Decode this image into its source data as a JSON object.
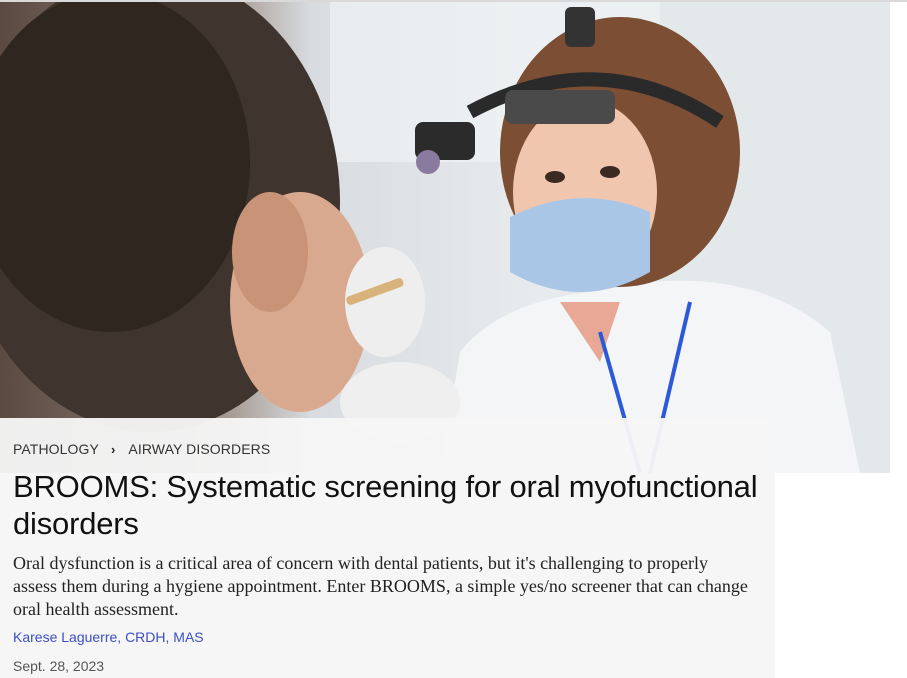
{
  "breadcrumb": {
    "items": [
      "PATHOLOGY",
      "AIRWAY DISORDERS"
    ]
  },
  "article": {
    "title": "BROOMS: Systematic screening for oral myofunctional disorders",
    "summary": "Oral dysfunction is a critical area of concern with dental patients, but it's challenging to properly assess them during a hygiene appointment. Enter BROOMS, a simple yes/no screener that can change oral health assessment.",
    "author": "Karese Laguerre, CRDH, MAS",
    "date": "Sept. 28, 2023"
  },
  "icons": {
    "breadcrumb_separator": "chevron-right-icon"
  },
  "colors": {
    "author_link": "#3b4fc4",
    "headline": "#111111",
    "card_background": "#f6f6f6"
  }
}
